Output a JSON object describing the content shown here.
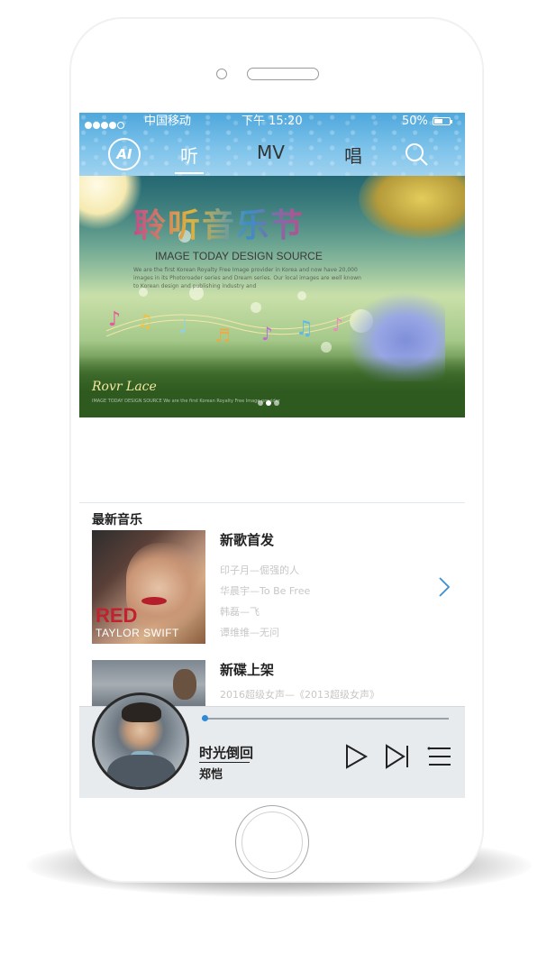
{
  "status_bar": {
    "carrier": "中国移动",
    "time": "下午 15:20",
    "battery": "50%"
  },
  "nav": {
    "ai_label": "AI",
    "tabs": [
      {
        "label": "听",
        "active": true
      },
      {
        "label": "MV",
        "active": false
      },
      {
        "label": "唱",
        "active": false
      }
    ],
    "search_icon": "search-icon"
  },
  "banner": {
    "title": "聆听音乐节",
    "subtitle": "IMAGE TODAY DESIGN SOURCE",
    "body": "We are the first Korean Royalty Free Image provider in Korea and now have 20,000 images in its Photoroader series and Dream series. Our local images are well known to Korean design and publishing industry and",
    "footer_brand": "Rovr Lace",
    "footer_small": "IMAGE TODAY DESIGN SOURCE We are the first Korean Royalty Free Image provider",
    "slides": 3,
    "active_slide": 1
  },
  "section": {
    "title": "最新音乐"
  },
  "cards": [
    {
      "heading": "新歌首发",
      "album_text": "RED",
      "album_artist": "TAYLOR SWIFT",
      "lines": [
        "印子月—倔强的人",
        "华晨宇—To Be Free",
        "韩磊—飞",
        "谭维维—无问"
      ]
    },
    {
      "heading": "新碟上架",
      "lines": [
        "2016超级女声—《2013超级女声》"
      ]
    }
  ],
  "player": {
    "title": "时光倒回",
    "artist": "郑恺",
    "progress": 0.01,
    "accent_color": "#2e8bd7"
  }
}
